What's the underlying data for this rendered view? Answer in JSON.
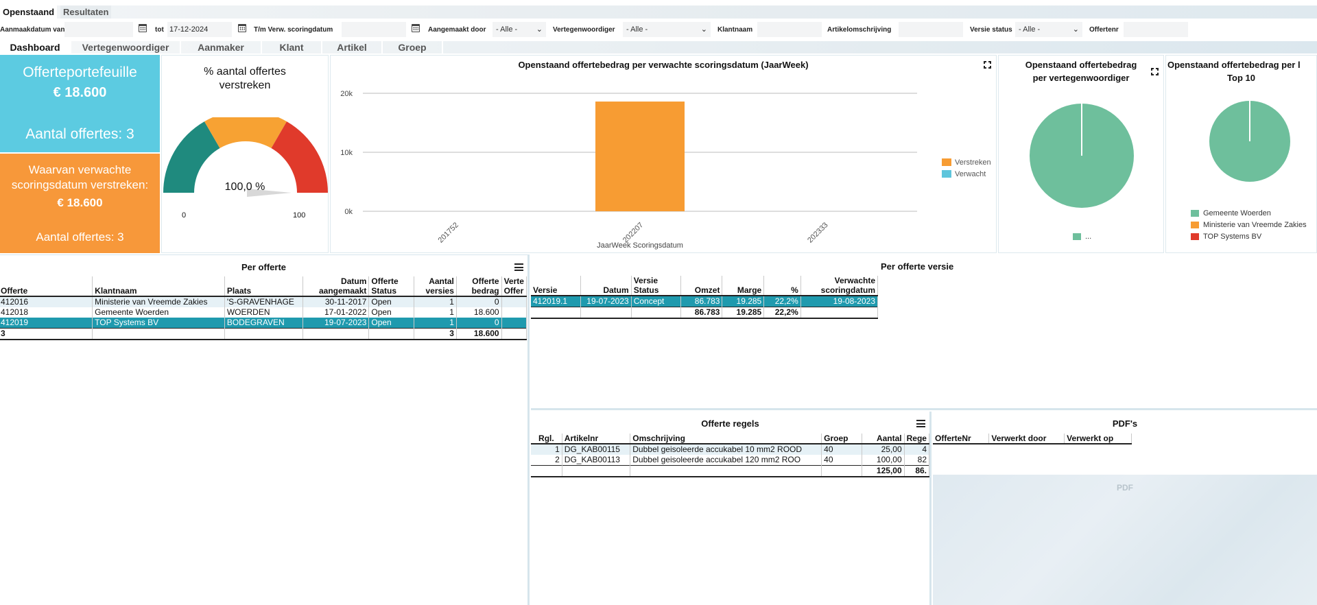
{
  "top_tabs": [
    "Openstaand",
    "Resultaten"
  ],
  "filters": {
    "aanmaakdatum_van_label": "Aanmaakdatum van",
    "tot_label": "tot",
    "tot_value": "17-12-2024",
    "tm_label": "T/m Verw. scoringdatum",
    "aangemaakt_door_label": "Aangemaakt door",
    "aangemaakt_door_value": "- Alle -",
    "vertegenwoordiger_label": "Vertegenwoordiger",
    "vertegenwoordiger_value": "- Alle -",
    "klantnaam_label": "Klantnaam",
    "artikelomschrijving_label": "Artikelomschrijving",
    "versie_status_label": "Versie status",
    "versie_status_value": "- Alle -",
    "offertenr_label": "Offertenr"
  },
  "sub_tabs": [
    "Dashboard",
    "Vertegenwoordiger",
    "Aanmaker",
    "Klant",
    "Artikel",
    "Groep"
  ],
  "kpi": {
    "portfolio_title": "Offerteportefeuille",
    "portfolio_amount": "€ 18.600",
    "portfolio_count": "Aantal offertes: 3",
    "expired_title_1": "Waarvan verwachte",
    "expired_title_2": "scoringsdatum verstreken:",
    "expired_amount": "€ 18.600",
    "expired_count": "Aantal offertes: 3"
  },
  "gauge": {
    "title_1": "% aantal offertes",
    "title_2": "verstreken",
    "value": 100.0,
    "value_label": "100,0 %",
    "min_label": "0",
    "max_label": "100",
    "colors": [
      "#1f8a7e",
      "#f7a233",
      "#e03a2b"
    ]
  },
  "bar_panel": {
    "title": "Openstaand offertebedrag per verwachte scoringsdatum (JaarWeek)"
  },
  "pie1": {
    "title_1": "Openstaand offertebedrag",
    "title_2": "per vertegenwoordiger",
    "legend": [
      "..."
    ]
  },
  "pie2": {
    "title_1": "Openstaand offertebedrag per l",
    "title_2": "Top 10",
    "legend": [
      "Gemeente Woerden",
      "Ministerie van Vreemde Zakies",
      "TOP Systems BV"
    ]
  },
  "chart_data": [
    {
      "type": "bar",
      "title": "Openstaand offertebedrag per verwachte scoringsdatum (JaarWeek)",
      "xlabel": "JaarWeek Scoringsdatum",
      "ylabel": "",
      "categories": [
        "201752",
        "202207",
        "202333"
      ],
      "series": [
        {
          "name": "Verstreken",
          "color": "#f79c33",
          "values": [
            0,
            18600,
            0
          ]
        },
        {
          "name": "Verwacht",
          "color": "#5ec5dc",
          "values": [
            0,
            0,
            0
          ]
        }
      ],
      "yticks": [
        "0k",
        "10k",
        "20k"
      ],
      "ylim": [
        0,
        20000
      ],
      "grid": true,
      "legend": "right"
    },
    {
      "type": "pie",
      "title": "Openstaand offertebedrag per vertegenwoordiger",
      "labels": [
        "..."
      ],
      "values": [
        18600
      ],
      "colors": [
        "#6ebf9c"
      ],
      "legend": "bottom"
    },
    {
      "type": "pie",
      "title": "Openstaand offertebedrag per l Top 10",
      "labels": [
        "Gemeente Woerden",
        "Ministerie van Vreemde Zakies",
        "TOP Systems BV"
      ],
      "values": [
        18600,
        0,
        0
      ],
      "colors": [
        "#6ebf9c",
        "#f79c33",
        "#e03a2b"
      ],
      "legend": "bottom"
    }
  ],
  "per_offerte": {
    "title": "Per offerte",
    "headers": [
      [
        "",
        "Offerte"
      ],
      [
        "",
        "Klantnaam"
      ],
      [
        "",
        "Plaats"
      ],
      [
        "Datum",
        "aangemaakt"
      ],
      [
        "Offerte",
        "Status"
      ],
      [
        "Aantal",
        "versies"
      ],
      [
        "Offerte",
        "bedrag"
      ],
      [
        "Verte",
        "Offer"
      ]
    ],
    "rows": [
      [
        "412016",
        "Ministerie van Vreemde Zakies",
        "'S-GRAVENHAGE",
        "30-11-2017",
        "Open",
        "1",
        "0",
        ""
      ],
      [
        "412018",
        "Gemeente Woerden",
        "WOERDEN",
        "17-01-2022",
        "Open",
        "1",
        "18.600",
        ""
      ],
      [
        "412019",
        "TOP Systems BV",
        "BODEGRAVEN",
        "19-07-2023",
        "Open",
        "1",
        "0",
        ""
      ]
    ],
    "total": [
      "3",
      "",
      "",
      "",
      "",
      "3",
      "18.600",
      ""
    ]
  },
  "per_versie": {
    "title": "Per offerte versie",
    "headers": [
      [
        "",
        "Versie"
      ],
      [
        "",
        "Datum"
      ],
      [
        "Versie",
        "Status"
      ],
      [
        "",
        "Omzet"
      ],
      [
        "",
        "Marge"
      ],
      [
        "",
        "%"
      ],
      [
        "Verwachte",
        "scoringdatum"
      ]
    ],
    "rows": [
      [
        "412019.1",
        "19-07-2023",
        "Concept",
        "86.783",
        "19.285",
        "22,2%",
        "19-08-2023"
      ]
    ],
    "total": [
      "",
      "",
      "",
      "86.783",
      "19.285",
      "22,2%",
      ""
    ]
  },
  "regels": {
    "title": "Offerte regels",
    "headers": [
      "Rgl.",
      "Artikelnr",
      "Omschrijving",
      "Groep",
      "Aantal",
      "Rege"
    ],
    "rows": [
      [
        "1",
        "DG_KAB00115",
        "Dubbel geisoleerde accukabel 10 mm2 ROOD",
        "40",
        "25,00",
        "4"
      ],
      [
        "2",
        "DG_KAB00113",
        "Dubbel geisoleerde accukabel 120 mm2 ROO",
        "40",
        "100,00",
        "82"
      ]
    ],
    "total": [
      "",
      "",
      "",
      "",
      "125,00",
      "86."
    ]
  },
  "pdfs": {
    "title": "PDF's",
    "headers": [
      "OfferteNr",
      "Verwerkt door",
      "Verwerkt op"
    ],
    "viewer_label": "PDF"
  }
}
